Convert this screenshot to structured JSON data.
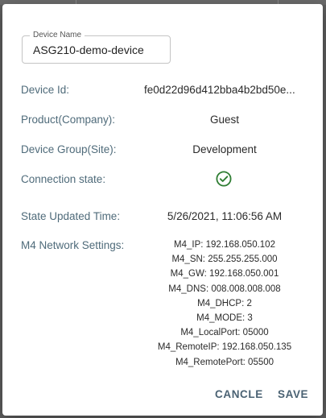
{
  "dialog": {
    "device_name_label": "Device Name",
    "device_name_value": "ASG210-demo-device",
    "fields": [
      {
        "label": "Device Id:",
        "value": "fe0d22d96d412bba4b2bd50e..."
      },
      {
        "label": "Product(Company):",
        "value": "Guest"
      },
      {
        "label": "Device Group(Site):",
        "value": "Development"
      },
      {
        "label": "Connection state:",
        "value_icon": "check-circle-icon",
        "status": "connected"
      },
      {
        "label": "State Updated Time:",
        "value": "5/26/2021, 11:06:56 AM"
      },
      {
        "label": "M4 Network Settings:"
      }
    ],
    "network_settings": [
      "M4_IP: 192.168.050.102",
      "M4_SN: 255.255.255.000",
      "M4_GW: 192.168.050.001",
      "M4_DNS: 008.008.008.008",
      "M4_DHCP: 2",
      "M4_MODE: 3",
      "M4_LocalPort: 05000",
      "M4_RemoteIP: 192.168.050.135",
      "M4_RemotePort: 05500"
    ],
    "buttons": {
      "cancel": "CANCLE",
      "save": "SAVE"
    }
  },
  "colors": {
    "label": "#4f6b7a",
    "success": "#2e7d32",
    "button": "#4a6273"
  }
}
